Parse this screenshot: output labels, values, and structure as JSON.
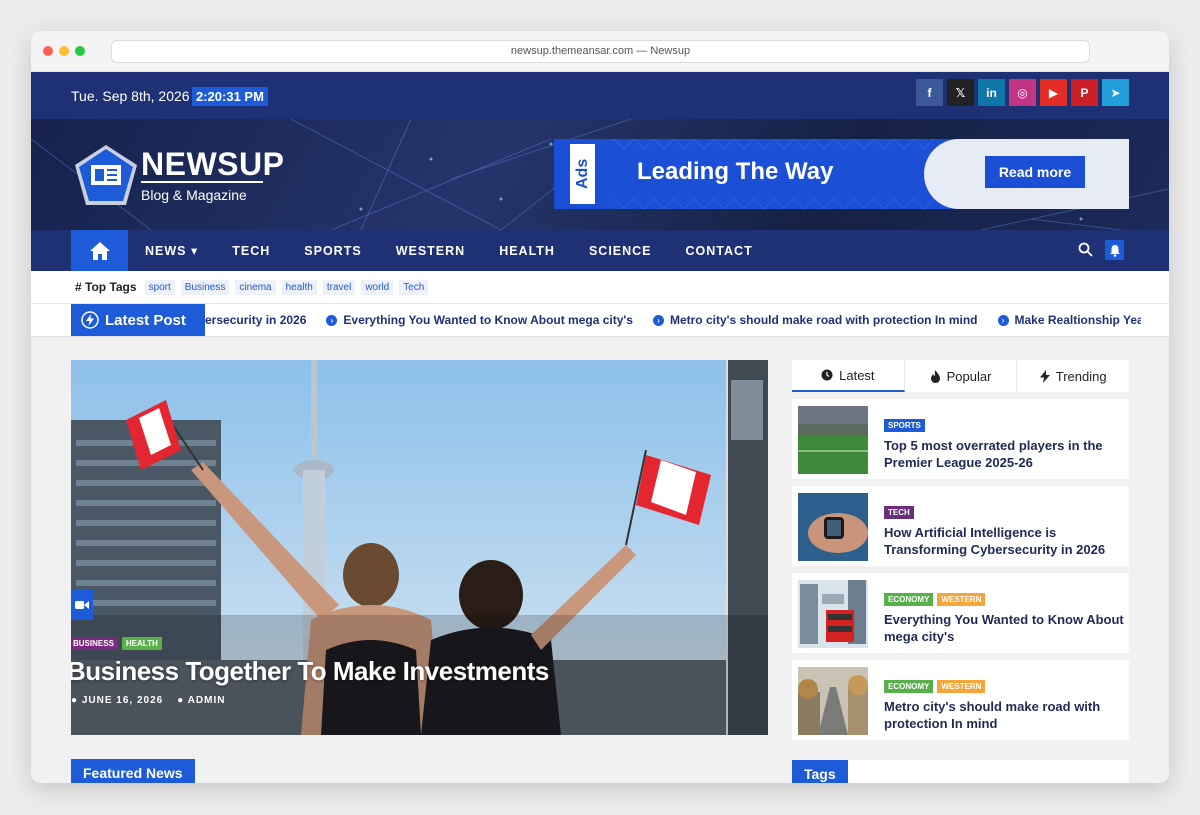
{
  "browser": {
    "url": "newsup.themeansar.com — Newsup"
  },
  "topbar": {
    "date": "Tue. Sep 8th, 2026",
    "time": "2:20:31 PM",
    "socials": [
      {
        "name": "facebook-icon",
        "glyph": "f",
        "color": "#3b5998"
      },
      {
        "name": "x-icon",
        "glyph": "𝕏",
        "color": "#222222"
      },
      {
        "name": "linkedin-icon",
        "glyph": "in",
        "color": "#0e76a8"
      },
      {
        "name": "instagram-icon",
        "glyph": "◎",
        "color": "#c13584"
      },
      {
        "name": "youtube-icon",
        "glyph": "▶",
        "color": "#e52d27"
      },
      {
        "name": "pinterest-icon",
        "glyph": "P",
        "color": "#cb2027"
      },
      {
        "name": "telegram-icon",
        "glyph": "➤",
        "color": "#229ed9"
      }
    ]
  },
  "header": {
    "logo_title": "NEWSUP",
    "logo_subtitle": "Blog & Magazine",
    "ad_label": "Ads",
    "ad_text": "Leading The Way",
    "ad_button": "Read more"
  },
  "nav": {
    "items": [
      "NEWS ▾",
      "TECH",
      "SPORTS",
      "WESTERN",
      "HEALTH",
      "SCIENCE",
      "CONTACT"
    ]
  },
  "top_tags": {
    "title": "# Top Tags",
    "tags": [
      "sport",
      "Business",
      "cinema",
      "health",
      "travel",
      "world",
      "Tech"
    ]
  },
  "ticker": {
    "label": "Latest Post",
    "items": [
      "ersecurity in 2026",
      "Everything You Wanted to Know About mega city's",
      "Metro city's should make road with protection In mind",
      "Make Realtionship Years Li"
    ]
  },
  "hero": {
    "categories": [
      {
        "label": "BUSINESS",
        "color": "#7b2a7f"
      },
      {
        "label": "HEALTH",
        "color": "#57b04a"
      }
    ],
    "title": "Business Together To Make Investments",
    "date": "JUNE 16, 2026",
    "author": "ADMIN"
  },
  "sidebar": {
    "tabs": [
      "Latest",
      "Popular",
      "Trending"
    ],
    "posts": [
      {
        "cats": [
          {
            "label": "SPORTS",
            "color": "#1e5bd8"
          }
        ],
        "title": "Top 5 most overrated players in the Premier League 2025-26",
        "thumb": "stadium"
      },
      {
        "cats": [
          {
            "label": "TECH",
            "color": "#6b2f7a"
          }
        ],
        "title": "How Artificial Intelligence is Transforming Cybersecurity in 2026",
        "thumb": "watch"
      },
      {
        "cats": [
          {
            "label": "ECONOMY",
            "color": "#57b04a"
          },
          {
            "label": "WESTERN",
            "color": "#f4a63a"
          }
        ],
        "title": "Everything You Wanted to Know About mega city's",
        "thumb": "bus"
      },
      {
        "cats": [
          {
            "label": "ECONOMY",
            "color": "#57b04a"
          },
          {
            "label": "WESTERN",
            "color": "#f4a63a"
          }
        ],
        "title": "Metro city's should make road with protection In mind",
        "thumb": "road"
      }
    ]
  },
  "featured_title": "Featured News",
  "tags_title": "Tags"
}
